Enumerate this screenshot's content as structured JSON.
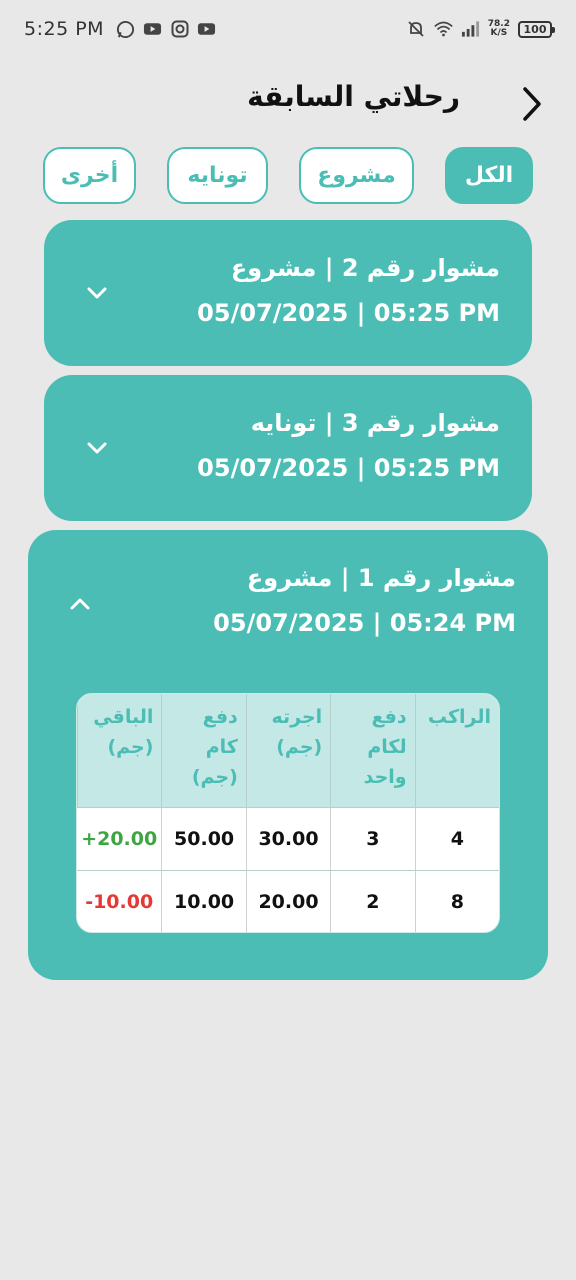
{
  "status_bar": {
    "time": "5:25 PM",
    "net_speed_value": "78.2",
    "net_speed_unit": "K/S",
    "battery": "100",
    "icons": [
      "whatsapp-icon",
      "youtube-icon",
      "instagram-icon",
      "youtube-icon",
      "mute-icon",
      "wifi-icon",
      "signal-icon"
    ]
  },
  "header": {
    "title": "رحلاتي السابقة",
    "back_icon": "chevron-right-icon"
  },
  "filters": {
    "all": "الكل",
    "project": "مشروع",
    "tonaya": "تونايه",
    "other": "أخرى",
    "selected": "all"
  },
  "trips": [
    {
      "title": "مشوار رقم 2  |  مشروع",
      "date": "05/07/2025 | 05:25 PM",
      "expanded": false
    },
    {
      "title": "مشوار رقم 3  |  تونايه",
      "date": "05/07/2025 | 05:25 PM",
      "expanded": false
    },
    {
      "title": "مشوار رقم 1  |  مشروع",
      "date": "05/07/2025 | 05:24 PM",
      "expanded": true
    }
  ],
  "table": {
    "headers": [
      "الراكب",
      "دفع لكام واحد",
      "اجرته (جم)",
      "دفع كام (جم)",
      "الباقي (جم)"
    ],
    "rows": [
      [
        "4",
        "3",
        "30.00",
        "50.00",
        "+20.00"
      ],
      [
        "8",
        "2",
        "20.00",
        "10.00",
        "-10.00"
      ]
    ]
  },
  "colors": {
    "accent": "#4bbdb5",
    "header_bg": "#c3e8e5",
    "positive": "#3fa442",
    "negative": "#e53935",
    "background": "#e8e8e8"
  }
}
